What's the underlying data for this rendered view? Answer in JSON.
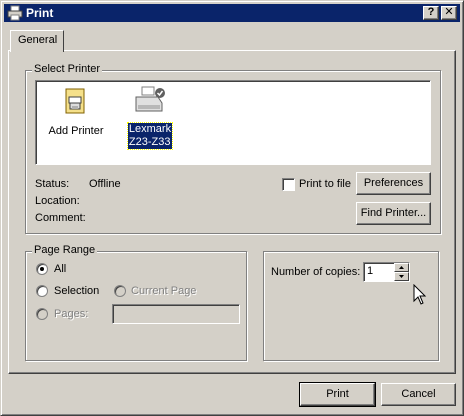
{
  "window": {
    "title": "Print",
    "help_button": "?",
    "close_button": "✕"
  },
  "tabs": [
    {
      "label": "General"
    }
  ],
  "select_printer": {
    "legend": "Select Printer",
    "printers": [
      {
        "label": "Add Printer",
        "icon": "add-printer-icon",
        "selected": false
      },
      {
        "label": "Lexmark Z23-Z33",
        "label_line1": "Lexmark",
        "label_line2": "Z23-Z33",
        "icon": "printer-icon",
        "selected": true
      }
    ],
    "status_label": "Status:",
    "status_value": "Offline",
    "location_label": "Location:",
    "location_value": "",
    "comment_label": "Comment:",
    "comment_value": "",
    "print_to_file": {
      "label": "Print to file",
      "checked": false
    },
    "preferences_button": "Preferences",
    "find_printer_button": "Find Printer..."
  },
  "page_range": {
    "legend": "Page Range",
    "all_label": "All",
    "selection_label": "Selection",
    "current_page_label": "Current Page",
    "pages_label": "Pages:",
    "pages_value": "",
    "selected": "All"
  },
  "copies": {
    "label": "Number of copies:",
    "value": "1"
  },
  "footer": {
    "print_button": "Print",
    "cancel_button": "Cancel"
  },
  "colors": {
    "titlebar": "#0a246a",
    "face": "#d4d0c8",
    "selection": "#0a246a"
  }
}
